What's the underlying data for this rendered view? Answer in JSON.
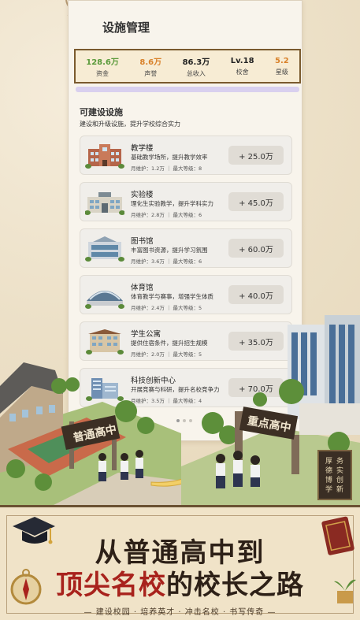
{
  "panel": {
    "title": "设施管理",
    "stats": [
      {
        "value": "128.6万",
        "label": "资金",
        "color": "#5a9a3a"
      },
      {
        "value": "8.6万",
        "label": "声誉",
        "color": "#d9822b"
      },
      {
        "value": "86.3万",
        "label": "总收入",
        "color": "#222222"
      },
      {
        "value": "Lv.18",
        "label": "校舍",
        "color": "#222222"
      },
      {
        "value": "5.2",
        "label": "星级",
        "color": "#d9822b"
      }
    ],
    "section_title": "可建设设施",
    "section_subtitle": "建设和升级设施，提升学校综合实力",
    "facilities": [
      {
        "name": "教学楼",
        "desc": "基础教学场所，提升教学效率",
        "meta": "月维护：1.2万 ｜ 最大等级：8",
        "cost": "+ 25.0万"
      },
      {
        "name": "实验楼",
        "desc": "理化生实验教学，提升学科实力",
        "meta": "月维护：2.8万 ｜ 最大等级：6",
        "cost": "+ 45.0万"
      },
      {
        "name": "图书馆",
        "desc": "丰富图书资源，提升学习氛围",
        "meta": "月维护：3.6万 ｜ 最大等级：6",
        "cost": "+ 60.0万"
      },
      {
        "name": "体育馆",
        "desc": "体育教学与赛事，增强学生体质",
        "meta": "月维护：2.4万 ｜ 最大等级：5",
        "cost": "+ 40.0万"
      },
      {
        "name": "学生公寓",
        "desc": "提供住宿条件，提升招生规模",
        "meta": "月维护：2.0万 ｜ 最大等级：5",
        "cost": "+ 35.0万"
      },
      {
        "name": "科技创新中心",
        "desc": "开展竞赛与科研，提升名校竞争力",
        "meta": "月维护：3.5万 ｜ 最大等级：4",
        "cost": "+ 70.0万"
      }
    ]
  },
  "scene": {
    "left_school_sign": "普通高中",
    "right_school_sign": "重点高中",
    "plaque_text": "厚德博学务实创新"
  },
  "banner": {
    "headline_line1": "从普通高中到",
    "headline_line2_red": "顶尖名校",
    "headline_line2_dark": "的校长之路",
    "tagline": "— 建设校园 · 培养英才 · 冲击名校 · 书写传奇 —"
  },
  "colors": {
    "accent_red": "#a8221c",
    "frame_brown": "#7a5a2e",
    "parchment": "#f0e3c8"
  }
}
